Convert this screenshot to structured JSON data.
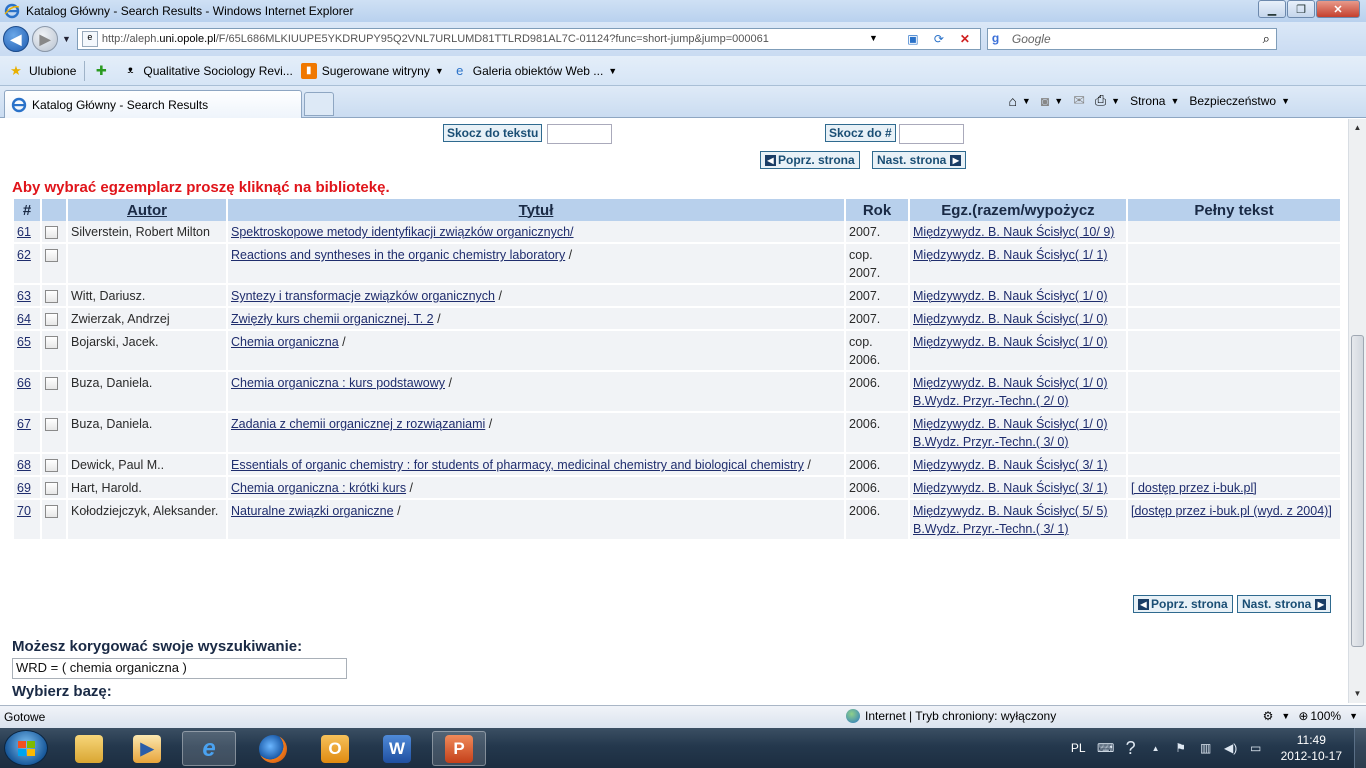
{
  "window": {
    "title": "Katalog Główny - Search Results - Windows Internet Explorer",
    "minimize": "▁",
    "maximize": "❐",
    "close": "✕"
  },
  "navigation": {
    "url_prefix": "http://aleph.",
    "url_domain": "uni.opole.pl",
    "url_rest": "/F/65L686MLKIUUPE5YKDRUPY95Q2VNL7URLUMD81TTLRD981AL7C-01124?func=short-jump&jump=000061",
    "search_placeholder": "Google"
  },
  "favorites": {
    "label": "Ulubione",
    "items": [
      {
        "label": "Qualitative Sociology Revi..."
      },
      {
        "label": "Sugerowane witryny"
      },
      {
        "label": "Galeria obiektów Web ..."
      }
    ]
  },
  "tab": {
    "active_label": "Katalog Główny - Search Results"
  },
  "commandbar": {
    "page": "Strona",
    "safety": "Bezpieczeństwo"
  },
  "jump": {
    "to_text": "Skocz do tekstu",
    "to_number": "Skocz do #"
  },
  "paging": {
    "prev": "Poprz. strona",
    "next": "Nast. strona"
  },
  "notice": "Aby wybrać egzemplarz proszę kliknąć na bibliotekę.",
  "table": {
    "headers": {
      "num": "#",
      "author": "Autor",
      "title": "Tytuł",
      "year": "Rok",
      "copies": "Egz.(razem/wypożycz",
      "fulltext": "Pełny tekst"
    },
    "rows": [
      {
        "num": "61",
        "author": "Silverstein, Robert Milton",
        "title": "Spektroskopowe metody identyfikacji związków organicznych/",
        "title_suffix": "",
        "year": "2007.",
        "copies": [
          "Międzywydz. B. Nauk Ścisłyc( 10/ 9)"
        ],
        "fulltext": ""
      },
      {
        "num": "62",
        "author": "",
        "title": "Reactions and syntheses in the organic chemistry laboratory",
        "title_suffix": " /",
        "year": "cop. 2007.",
        "copies": [
          "Międzywydz. B. Nauk Ścisłyc( 1/ 1)"
        ],
        "fulltext": ""
      },
      {
        "num": "63",
        "author": "Witt, Dariusz.",
        "title": "Syntezy i transformacje związków organicznych",
        "title_suffix": " /",
        "year": "2007.",
        "copies": [
          "Międzywydz. B. Nauk Ścisłyc( 1/ 0)"
        ],
        "fulltext": ""
      },
      {
        "num": "64",
        "author": "Zwierzak, Andrzej",
        "title": "Zwięzły kurs chemii organicznej. T. 2",
        "title_suffix": " /",
        "year": "2007.",
        "copies": [
          "Międzywydz. B. Nauk Ścisłyc( 1/ 0)"
        ],
        "fulltext": ""
      },
      {
        "num": "65",
        "author": "Bojarski, Jacek.",
        "title": "Chemia organiczna",
        "title_suffix": " /",
        "year": "cop. 2006.",
        "copies": [
          "Międzywydz. B. Nauk Ścisłyc( 1/ 0)"
        ],
        "fulltext": ""
      },
      {
        "num": "66",
        "author": "Buza, Daniela.",
        "title": "Chemia organiczna : kurs podstawowy",
        "title_suffix": " /",
        "year": "2006.",
        "copies": [
          "Międzywydz. B. Nauk Ścisłyc( 1/ 0)",
          "B.Wydz. Przyr.-Techn.( 2/ 0)"
        ],
        "fulltext": ""
      },
      {
        "num": "67",
        "author": "Buza, Daniela.",
        "title": "Zadania z chemii organicznej z rozwiązaniami",
        "title_suffix": " /",
        "year": "2006.",
        "copies": [
          "Międzywydz. B. Nauk Ścisłyc( 1/ 0)",
          "B.Wydz. Przyr.-Techn.( 3/ 0)"
        ],
        "fulltext": ""
      },
      {
        "num": "68",
        "author": "Dewick, Paul M..",
        "title": "Essentials of organic chemistry : for students of pharmacy, medicinal chemistry and biological chemistry",
        "title_suffix": " /",
        "year": "2006.",
        "copies": [
          "Międzywydz. B. Nauk Ścisłyc( 3/ 1)"
        ],
        "fulltext": ""
      },
      {
        "num": "69",
        "author": "Hart, Harold.",
        "title": "Chemia organiczna : krótki kurs",
        "title_suffix": " /",
        "year": "2006.",
        "copies": [
          "Międzywydz. B. Nauk Ścisłyc( 3/ 1)"
        ],
        "fulltext": "[ dostęp przez i-buk.pl]"
      },
      {
        "num": "70",
        "author": "Kołodziejczyk, Aleksander.",
        "title": "Naturalne związki organiczne",
        "title_suffix": " /",
        "year": "2006.",
        "copies": [
          "Międzywydz. B. Nauk Ścisłyc( 5/ 5)",
          "B.Wydz. Przyr.-Techn.( 3/ 1)"
        ],
        "fulltext": "[dostęp przez i-buk.pl (wyd. z 2004)]"
      }
    ]
  },
  "refine": {
    "title": "Możesz korygować swoje wyszukiwanie:",
    "query": "WRD = ( chemia organiczna )"
  },
  "base": {
    "title": "Wybierz bazę:"
  },
  "statusbar": {
    "status": "Gotowe",
    "zone": "Internet | Tryb chroniony: wyłączony",
    "zoom": "100%"
  },
  "taskbar": {
    "lang": "PL",
    "time": "11:49",
    "date": "2012-10-17"
  }
}
